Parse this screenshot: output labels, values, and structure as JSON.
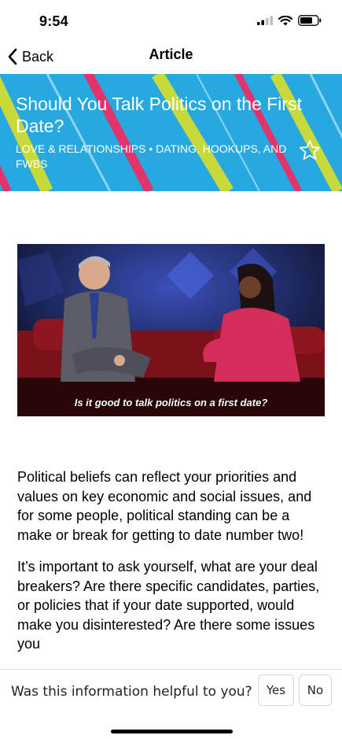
{
  "status_bar": {
    "time": "9:54",
    "icons": [
      "signal-icon",
      "wifi-icon",
      "battery-icon"
    ]
  },
  "nav": {
    "back_label": "Back",
    "title": "Article",
    "back_icon": "chevron-left-icon"
  },
  "hero": {
    "title": "Should You Talk Politics on the First Date?",
    "categories": "LOVE & RELATIONSHIPS • DATING, HOOKUPS, AND FWBS",
    "favorite_icon": "star-outline-icon",
    "background_color": "#27a9df",
    "stripe_colors": [
      "#e2336b",
      "#c7d93b",
      "#8fd3f4"
    ]
  },
  "video": {
    "caption": "Is it good to talk politics on a first date?"
  },
  "article": {
    "paragraphs": [
      "Political beliefs can reflect your priorities and values on key economic and social issues, and for some people, political standing can be a make or break for getting to date number two!",
      "It’s important to ask yourself, what are your deal breakers? Are there specific candidates, parties, or policies that if your date supported, would make you disinterested? Are there some issues you"
    ]
  },
  "feedback": {
    "question": "Was this information helpful to you?",
    "yes_label": "Yes",
    "no_label": "No"
  }
}
